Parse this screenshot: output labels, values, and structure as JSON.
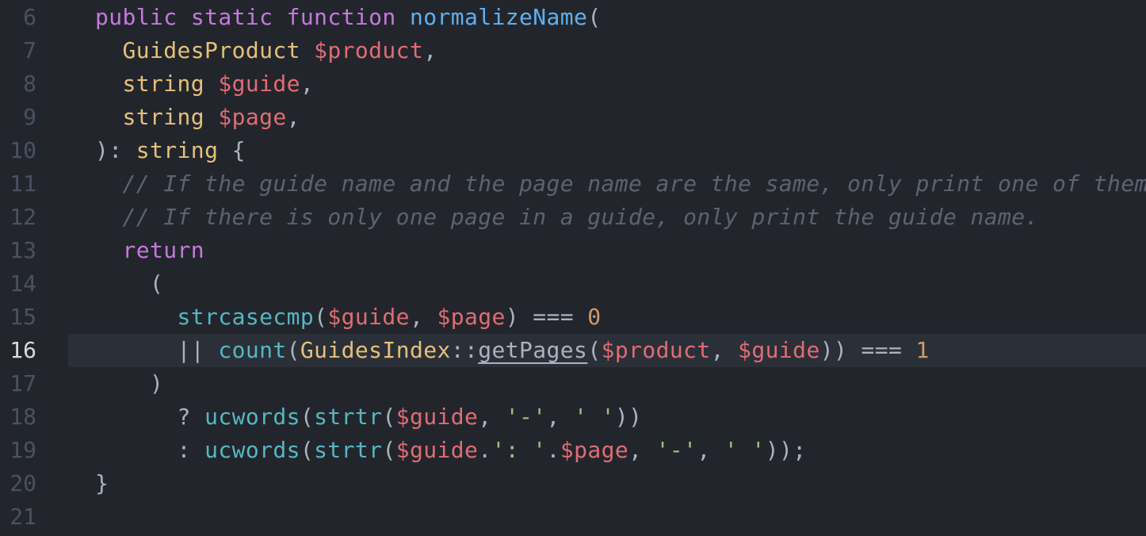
{
  "editor": {
    "active_line": "16",
    "colors": {
      "background": "#22262c",
      "keyword": "#c678dd",
      "function": "#61afef",
      "type": "#e5c07b",
      "variable": "#e06c75",
      "comment": "#5c6370",
      "builtin": "#56b6c2",
      "number": "#d19a66",
      "string": "#98c379"
    },
    "lines": [
      {
        "num": "6",
        "tokens": [
          {
            "t": "public",
            "c": "kw"
          },
          {
            "t": " ",
            "c": "pl"
          },
          {
            "t": "static",
            "c": "kw"
          },
          {
            "t": " ",
            "c": "pl"
          },
          {
            "t": "function",
            "c": "kw"
          },
          {
            "t": " ",
            "c": "pl"
          },
          {
            "t": "normalizeName",
            "c": "fn"
          },
          {
            "t": "(",
            "c": "pl"
          }
        ]
      },
      {
        "num": "7",
        "tokens": [
          {
            "t": "  ",
            "c": "pl"
          },
          {
            "t": "GuidesProduct",
            "c": "type"
          },
          {
            "t": " ",
            "c": "pl"
          },
          {
            "t": "$product",
            "c": "var"
          },
          {
            "t": ",",
            "c": "pl"
          }
        ]
      },
      {
        "num": "8",
        "tokens": [
          {
            "t": "  ",
            "c": "pl"
          },
          {
            "t": "string",
            "c": "type"
          },
          {
            "t": " ",
            "c": "pl"
          },
          {
            "t": "$guide",
            "c": "var"
          },
          {
            "t": ",",
            "c": "pl"
          }
        ]
      },
      {
        "num": "9",
        "tokens": [
          {
            "t": "  ",
            "c": "pl"
          },
          {
            "t": "string",
            "c": "type"
          },
          {
            "t": " ",
            "c": "pl"
          },
          {
            "t": "$page",
            "c": "var"
          },
          {
            "t": ",",
            "c": "pl"
          }
        ]
      },
      {
        "num": "10",
        "tokens": [
          {
            "t": "): ",
            "c": "pl"
          },
          {
            "t": "string",
            "c": "type"
          },
          {
            "t": " {",
            "c": "pl"
          }
        ]
      },
      {
        "num": "11",
        "tokens": [
          {
            "t": "  // If the guide name and the page name are the same, only print one of them.",
            "c": "cmt"
          }
        ]
      },
      {
        "num": "12",
        "tokens": [
          {
            "t": "  // If there is only one page in a guide, only print the guide name.",
            "c": "cmt"
          }
        ]
      },
      {
        "num": "13",
        "tokens": [
          {
            "t": "  ",
            "c": "pl"
          },
          {
            "t": "return",
            "c": "kw"
          }
        ]
      },
      {
        "num": "14",
        "tokens": [
          {
            "t": "    (",
            "c": "pl"
          }
        ]
      },
      {
        "num": "15",
        "tokens": [
          {
            "t": "      ",
            "c": "pl"
          },
          {
            "t": "strcasecmp",
            "c": "call"
          },
          {
            "t": "(",
            "c": "pl"
          },
          {
            "t": "$guide",
            "c": "var"
          },
          {
            "t": ", ",
            "c": "pl"
          },
          {
            "t": "$page",
            "c": "var"
          },
          {
            "t": ") === ",
            "c": "pl"
          },
          {
            "t": "0",
            "c": "num"
          }
        ]
      },
      {
        "num": "16",
        "tokens": [
          {
            "t": "      || ",
            "c": "pl"
          },
          {
            "t": "count",
            "c": "call"
          },
          {
            "t": "(",
            "c": "pl"
          },
          {
            "t": "GuidesIndex",
            "c": "type"
          },
          {
            "t": "::",
            "c": "pl"
          },
          {
            "t": "getPages",
            "c": "pl",
            "u": true
          },
          {
            "t": "(",
            "c": "pl"
          },
          {
            "t": "$product",
            "c": "var"
          },
          {
            "t": ", ",
            "c": "pl"
          },
          {
            "t": "$guide",
            "c": "var"
          },
          {
            "t": ")) === ",
            "c": "pl"
          },
          {
            "t": "1",
            "c": "num"
          }
        ]
      },
      {
        "num": "17",
        "tokens": [
          {
            "t": "    )",
            "c": "pl"
          }
        ]
      },
      {
        "num": "18",
        "tokens": [
          {
            "t": "      ? ",
            "c": "pl"
          },
          {
            "t": "ucwords",
            "c": "call"
          },
          {
            "t": "(",
            "c": "pl"
          },
          {
            "t": "strtr",
            "c": "call"
          },
          {
            "t": "(",
            "c": "pl"
          },
          {
            "t": "$guide",
            "c": "var"
          },
          {
            "t": ", ",
            "c": "pl"
          },
          {
            "t": "'-'",
            "c": "str"
          },
          {
            "t": ", ",
            "c": "pl"
          },
          {
            "t": "' '",
            "c": "str"
          },
          {
            "t": "))",
            "c": "pl"
          }
        ]
      },
      {
        "num": "19",
        "tokens": [
          {
            "t": "      : ",
            "c": "pl"
          },
          {
            "t": "ucwords",
            "c": "call"
          },
          {
            "t": "(",
            "c": "pl"
          },
          {
            "t": "strtr",
            "c": "call"
          },
          {
            "t": "(",
            "c": "pl"
          },
          {
            "t": "$guide",
            "c": "var"
          },
          {
            "t": ".",
            "c": "pl"
          },
          {
            "t": "': '",
            "c": "str"
          },
          {
            "t": ".",
            "c": "pl"
          },
          {
            "t": "$page",
            "c": "var"
          },
          {
            "t": ", ",
            "c": "pl"
          },
          {
            "t": "'-'",
            "c": "str"
          },
          {
            "t": ", ",
            "c": "pl"
          },
          {
            "t": "' '",
            "c": "str"
          },
          {
            "t": "));",
            "c": "pl"
          }
        ]
      },
      {
        "num": "20",
        "tokens": [
          {
            "t": "}",
            "c": "pl"
          }
        ]
      },
      {
        "num": "21",
        "tokens": []
      }
    ]
  }
}
